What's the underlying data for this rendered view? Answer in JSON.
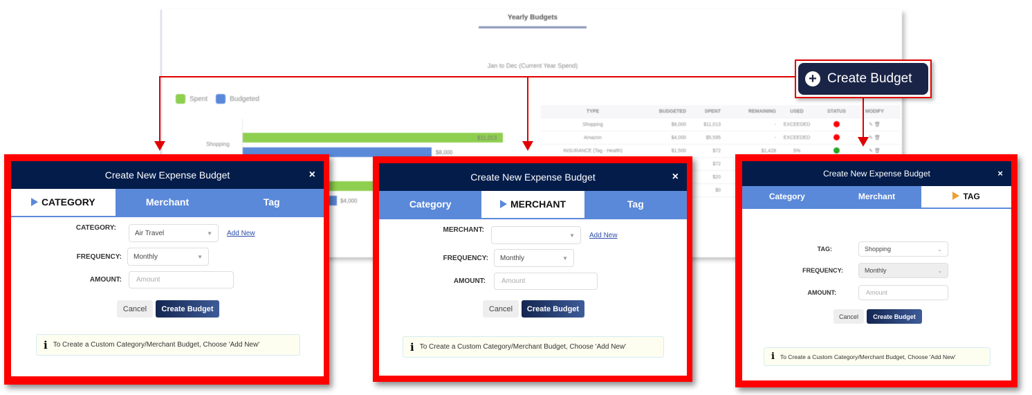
{
  "background": {
    "title": "Yearly Budgets",
    "subtitle": "Jan to Dec (Current Year Spend)",
    "legend": [
      {
        "label": "Spent",
        "color": "#8fcf50"
      },
      {
        "label": "Budgeted",
        "color": "#5b89d9"
      }
    ],
    "chart_rows": [
      {
        "label": "Shopping",
        "spent_label": "$11,013",
        "budget_label": "$8,000"
      },
      {
        "label": "",
        "spent_label": "",
        "budget_label": "$4,000"
      }
    ],
    "table": {
      "headers": [
        "TYPE",
        "BUDGETED",
        "SPENT",
        "REMAINING",
        "USED",
        "STATUS",
        "MODIFY"
      ],
      "rows": [
        {
          "type": "Shopping",
          "budgeted": "$8,000",
          "spent": "$11,013",
          "remaining": "-",
          "used": "EXCEEDED",
          "status": "red"
        },
        {
          "type": "Amazon",
          "budgeted": "$4,000",
          "spent": "$5,595",
          "remaining": "-",
          "used": "EXCEEDED",
          "status": "red"
        },
        {
          "type": "INSURANCE (Tag - Health)",
          "budgeted": "$1,500",
          "spent": "$72",
          "remaining": "$1,428",
          "used": "5%",
          "status": "green"
        },
        {
          "type": "",
          "budgeted": "",
          "spent": "$72",
          "remaining": "",
          "used": "",
          "status": ""
        },
        {
          "type": "",
          "budgeted": "",
          "spent": "$20",
          "remaining": "",
          "used": "",
          "status": ""
        },
        {
          "type": "",
          "budgeted": "",
          "spent": "$0",
          "remaining": "",
          "used": "",
          "status": ""
        }
      ]
    }
  },
  "create_budget_button": {
    "label": "Create Budget",
    "icon": "plus-circle-icon"
  },
  "dialogs": [
    {
      "title": "Create New Expense Budget",
      "close": "×",
      "tabs": [
        "CATEGORY",
        "Merchant",
        "Tag"
      ],
      "active_tab": 0,
      "fields": [
        {
          "label": "CATEGORY:",
          "value": "Air Travel",
          "type": "select",
          "add_new": "Add New"
        },
        {
          "label": "FREQUENCY:",
          "value": "Monthly",
          "type": "select"
        },
        {
          "label": "AMOUNT:",
          "placeholder": "Amount",
          "type": "input"
        }
      ],
      "cancel": "Cancel",
      "create": "Create Budget",
      "info": "To Create a Custom Category/Merchant Budget, Choose 'Add New'"
    },
    {
      "title": "Create New Expense Budget",
      "close": "×",
      "tabs": [
        "Category",
        "MERCHANT",
        "Tag"
      ],
      "active_tab": 1,
      "fields": [
        {
          "label": "MERCHANT:",
          "value": "",
          "type": "select",
          "add_new": "Add New"
        },
        {
          "label": "FREQUENCY:",
          "value": "Monthly",
          "type": "select"
        },
        {
          "label": "AMOUNT:",
          "placeholder": "Amount",
          "type": "input"
        }
      ],
      "cancel": "Cancel",
      "create": "Create Budget",
      "info": "To Create a Custom Category/Merchant Budget, Choose 'Add New'"
    },
    {
      "title": "Create New Expense Budget",
      "close": "×",
      "tabs": [
        "Category",
        "Merchant",
        "TAG"
      ],
      "active_tab": 2,
      "fields": [
        {
          "label": "TAG:",
          "value": "Shopping",
          "type": "select"
        },
        {
          "label": "FREQUENCY:",
          "value": "Monthly",
          "type": "select"
        },
        {
          "label": "AMOUNT:",
          "placeholder": "Amount",
          "type": "input"
        }
      ],
      "cancel": "Cancel",
      "create": "Create Budget",
      "info": "To Create a Custom Category/Merchant Budget, Choose 'Add New'"
    }
  ],
  "colors": {
    "header_navy": "#031c4a",
    "tab_blue": "#5b89d9",
    "highlight_red": "#ff0000",
    "tag_arrow_orange": "#f0a030"
  }
}
